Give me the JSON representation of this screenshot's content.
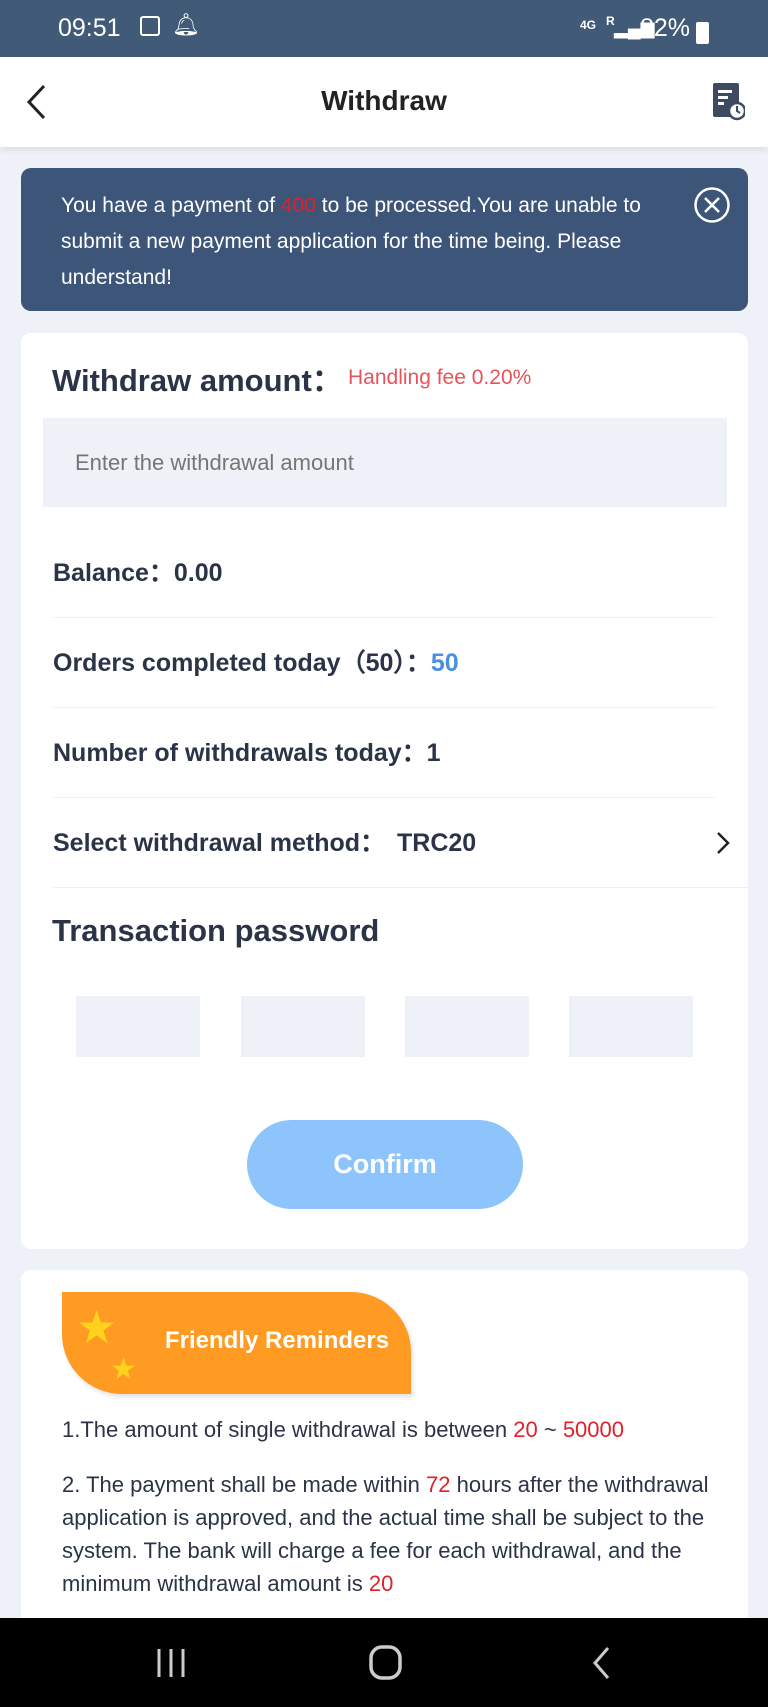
{
  "status_bar": {
    "time": "09:51",
    "network": "4G",
    "roaming": "R",
    "battery": "82%"
  },
  "header": {
    "title": "Withdraw",
    "back_icon": "chevron-left-icon",
    "history_icon": "record-clock-icon"
  },
  "notice": {
    "text_before": "You have a payment of ",
    "amount": "400",
    "text_after": " to be processed.You are unable to submit a new payment application for the time being. Please understand!",
    "close_icon": "close-circle-icon"
  },
  "form": {
    "amount_label": "Withdraw amount：",
    "fee": "Handling fee 0.20%",
    "amount_placeholder": "Enter the withdrawal amount",
    "balance_label": "Balance：",
    "balance": "0.00",
    "orders_label": "Orders completed today（50）：",
    "orders": "50",
    "withdrawals_label": "Number of withdrawals today：",
    "withdrawals": "1",
    "method_label": "Select withdrawal method：",
    "method": "TRC20",
    "password_label": "Transaction password",
    "confirm": "Confirm"
  },
  "reminders": {
    "title": "Friendly Reminders",
    "r1_before": "1.The amount of single withdrawal is between ",
    "r1_min": "20",
    "r1_sep": " ~ ",
    "r1_max": "50000",
    "r2_before": "2. The payment shall be made within ",
    "r2_hours": "72",
    "r2_after": " hours after the withdrawal application is approved, and the actual time shall be subject to the system. The bank will charge a fee for each withdrawal, and the minimum withdrawal amount is ",
    "r2_min": "20"
  },
  "colors": {
    "accent": "#4a90e2",
    "danger": "#e0202a",
    "header_bg": "#3d5578",
    "reminder_badge": "#ff9a22",
    "confirm_disabled": "#8cc4fb"
  }
}
